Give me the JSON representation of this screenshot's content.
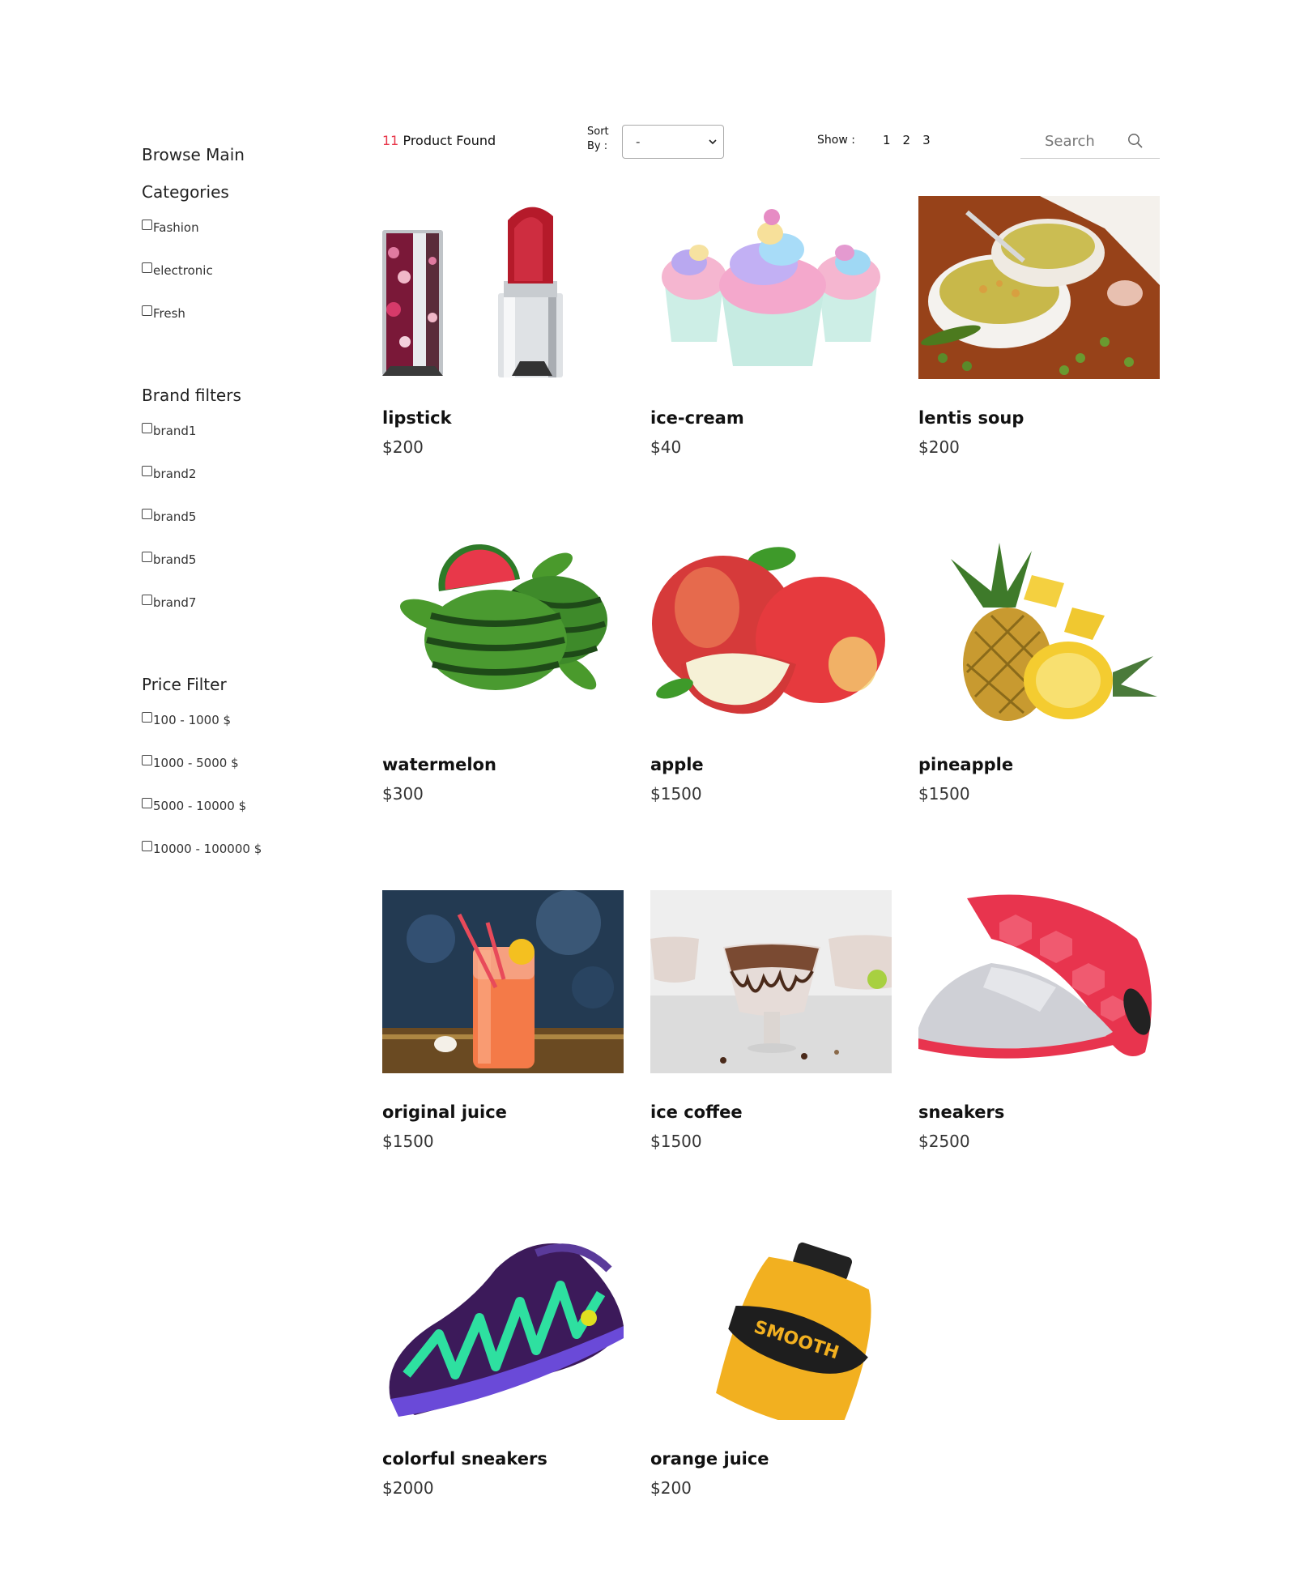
{
  "sidebar": {
    "categories_title_line1": "Browse Main",
    "categories_title_line2": "Categories",
    "categories": [
      "Fashion",
      "electronic",
      "Fresh"
    ],
    "brand_title": "Brand filters",
    "brands": [
      "brand1",
      "brand2",
      "brand5",
      "brand5",
      "brand7"
    ],
    "price_title": "Price Filter",
    "prices": [
      "100 - 1000 $",
      "1000 - 5000 $",
      "5000 - 10000 $",
      "10000 - 100000 $"
    ]
  },
  "toolbar": {
    "found_count": "11",
    "found_label": " Product Found",
    "sort_label_line1": "Sort",
    "sort_label_line2": "By :",
    "sort_value": "-",
    "show_label": "Show :",
    "pages": [
      "1",
      "2",
      "3"
    ],
    "search_placeholder": "Search"
  },
  "products": [
    {
      "name": "lipstick",
      "price": "$200",
      "icon": "lipstick-image"
    },
    {
      "name": "ice-cream",
      "price": "$40",
      "icon": "cupcakes-image"
    },
    {
      "name": "lentis soup",
      "price": "$200",
      "icon": "soup-image"
    },
    {
      "name": "watermelon",
      "price": "$300",
      "icon": "watermelon-image"
    },
    {
      "name": "apple",
      "price": "$1500",
      "icon": "apple-image"
    },
    {
      "name": "pineapple",
      "price": "$1500",
      "icon": "pineapple-image"
    },
    {
      "name": "original juice",
      "price": "$1500",
      "icon": "juice-jar-image"
    },
    {
      "name": "ice coffee",
      "price": "$1500",
      "icon": "ice-coffee-image"
    },
    {
      "name": "sneakers",
      "price": "$2500",
      "icon": "sneaker-image"
    },
    {
      "name": "colorful sneakers",
      "price": "$2000",
      "icon": "colorful-sneaker-image"
    },
    {
      "name": "orange juice",
      "price": "$200",
      "icon": "orange-juice-bottle-image"
    }
  ],
  "colors": {
    "accent": "#e8374a",
    "text": "#111111"
  }
}
